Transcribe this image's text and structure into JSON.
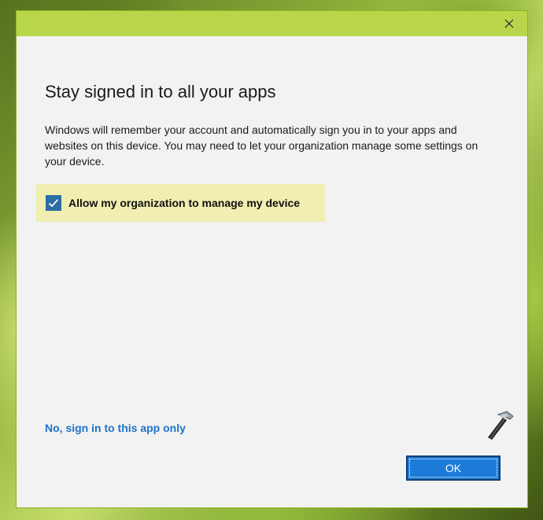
{
  "dialog": {
    "heading": "Stay signed in to all your apps",
    "body": "Windows will remember your account and automatically sign you in to your apps and websites on this device. You may need to let your organization manage some settings on your device.",
    "checkbox": {
      "label": "Allow my organization to manage my device",
      "checked": true
    },
    "alt_link": "No, sign in to this app only",
    "ok_label": "OK"
  },
  "icons": {
    "close": "close-icon",
    "check": "checkmark-icon",
    "watermark": "hammer-icon"
  },
  "colors": {
    "titlebar": "#b9d64a",
    "checkbox_highlight": "#f0eeb0",
    "checkbox_fill": "#2b6ea6",
    "link": "#1e73c8",
    "ok_button": "#1c7bd9"
  }
}
